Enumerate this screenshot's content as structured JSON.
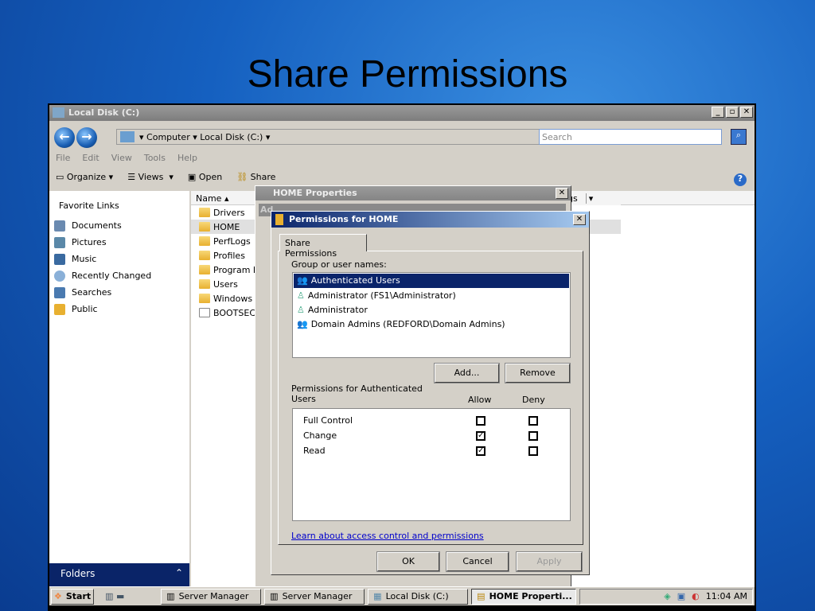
{
  "slide_title": "Share Permissions",
  "explorer": {
    "title": "Local Disk (C:)",
    "breadcrumb": [
      "Computer",
      "Local Disk (C:)"
    ],
    "search_placeholder": "Search",
    "menu": [
      "File",
      "Edit",
      "View",
      "Tools",
      "Help"
    ],
    "toolbar": {
      "organize": "Organize",
      "views": "Views",
      "open": "Open",
      "share": "Share"
    },
    "favorites_header": "Favorite Links",
    "favorites": [
      "Documents",
      "Pictures",
      "Music",
      "Recently Changed",
      "Searches",
      "Public"
    ],
    "folders_label": "Folders",
    "column_name": "Name",
    "column_tags": "gs",
    "files": [
      "Drivers",
      "HOME",
      "PerfLogs",
      "Profiles",
      "Program F",
      "Users",
      "Windows",
      "BOOTSEC"
    ]
  },
  "home_properties": {
    "title": "HOME Properties",
    "tab_partial": "Ad"
  },
  "permissions": {
    "title": "Permissions for HOME",
    "tab": "Share Permissions",
    "group_label": "Group or user names:",
    "users": [
      "Authenticated Users",
      "Administrator (FS1\\Administrator)",
      "Administrator",
      "Domain Admins (REDFORD\\Domain Admins)"
    ],
    "selected_user": "Authenticated Users",
    "add": "Add...",
    "remove": "Remove",
    "perm_label": "Permissions for Authenticated Users",
    "allow": "Allow",
    "deny": "Deny",
    "perms": [
      {
        "name": "Full Control",
        "allow": false,
        "deny": false
      },
      {
        "name": "Change",
        "allow": true,
        "deny": false
      },
      {
        "name": "Read",
        "allow": true,
        "deny": false
      }
    ],
    "link": "Learn about access control and permissions",
    "ok": "OK",
    "cancel": "Cancel",
    "apply": "Apply"
  },
  "taskbar": {
    "start": "Start",
    "tasks": [
      "Server Manager",
      "Server Manager",
      "Local Disk (C:)",
      "HOME Properti..."
    ],
    "clock": "11:04 AM"
  }
}
